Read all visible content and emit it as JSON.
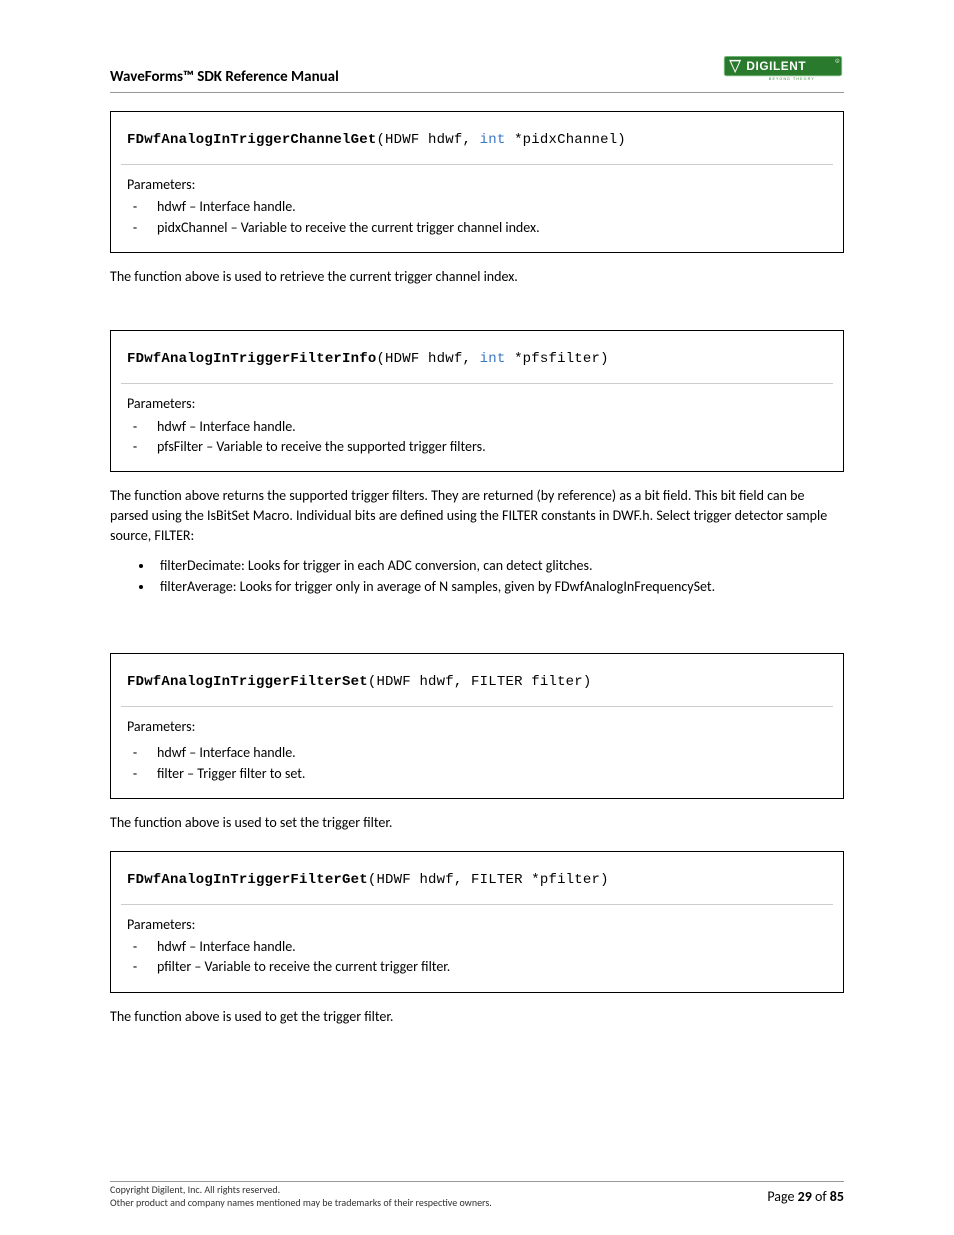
{
  "header": {
    "title": "WaveForms™ SDK Reference Manual",
    "logo_brand": "DIGILENT",
    "logo_tagline": "BEYOND THEORY"
  },
  "blocks": [
    {
      "fname": "FDwfAnalogInTriggerChannelGet",
      "sig_open": "(HDWF hdwf, ",
      "kw": "int",
      "sig_close": " *pidxChannel)",
      "params_label": "Parameters:",
      "params": [
        "hdwf – Interface handle.",
        "pidxChannel – Variable to receive the current trigger channel index."
      ],
      "after_text": "The function above is used to retrieve the current trigger channel index."
    },
    {
      "fname": "FDwfAnalogInTriggerFilterInfo",
      "sig_open": "(HDWF hdwf, ",
      "kw": "int",
      "sig_close": " *pfsfilter)",
      "params_label": "Parameters:",
      "params": [
        "hdwf – Interface handle.",
        "pfsFilter – Variable to receive the supported trigger filters."
      ],
      "after_text": "The function above returns the supported trigger filters. They are returned (by reference) as a bit field. This bit field can be parsed using the IsBitSet Macro. Individual bits are defined using the FILTER constants in DWF.h. Select trigger detector sample source, FILTER:",
      "bullets": [
        "filterDecimate: Looks for trigger in each ADC conversion, can detect glitches.",
        "filterAverage: Looks for trigger only in average of N samples, given by FDwfAnalogInFrequencySet."
      ]
    },
    {
      "fname": "FDwfAnalogInTriggerFilterSet",
      "sig_open": "(HDWF hdwf, FILTER filter)",
      "kw": "",
      "sig_close": "",
      "params_label": "Parameters:",
      "params": [
        "hdwf – Interface handle.",
        "filter – Trigger filter to set."
      ],
      "after_text": "The function above is used to set the trigger filter."
    },
    {
      "fname": "FDwfAnalogInTriggerFilterGet",
      "sig_open": "(HDWF hdwf, FILTER *pfilter)",
      "kw": "",
      "sig_close": "",
      "params_label": "Parameters:",
      "params": [
        "hdwf – Interface handle.",
        "pfilter – Variable to receive the current trigger filter."
      ],
      "after_text": "The function above is used to get the trigger filter."
    }
  ],
  "footer": {
    "line1": "Copyright Digilent, Inc. All rights reserved.",
    "line2": "Other product and company names mentioned may be trademarks of their respective owners.",
    "page_label": "Page ",
    "page_num": "29",
    "page_of": " of ",
    "page_total": "85"
  }
}
